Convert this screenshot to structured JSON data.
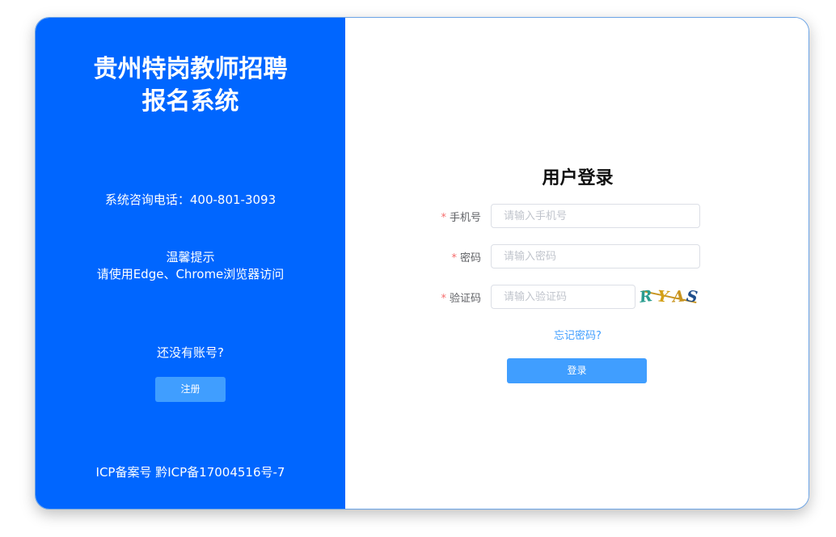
{
  "left": {
    "title_line1": "贵州特岗教师招聘",
    "title_line2": "报名系统",
    "hotline": "系统咨询电话：400-801-3093",
    "tip_title": "温馨提示",
    "tip_text": "请使用Edge、Chrome浏览器访问",
    "no_account": "还没有账号?",
    "register_label": "注册",
    "icp": "ICP备案号 黔ICP备17004516号-7"
  },
  "login": {
    "title": "用户登录",
    "required_mark": "*",
    "phone_label": "手机号",
    "phone_placeholder": "请输入手机号",
    "phone_value": "",
    "password_label": "密码",
    "password_placeholder": "请输入密码",
    "password_value": "",
    "captcha_label": "验证码",
    "captcha_placeholder": "请输入验证码",
    "captcha_value": "",
    "captcha_chars": [
      "R",
      "Y",
      "A",
      "S"
    ],
    "forgot_label": "忘记密码?",
    "submit_label": "登录"
  },
  "colors": {
    "brand_blue": "#0066ff",
    "button_blue": "#409eff",
    "required_red": "#f56c6c"
  }
}
